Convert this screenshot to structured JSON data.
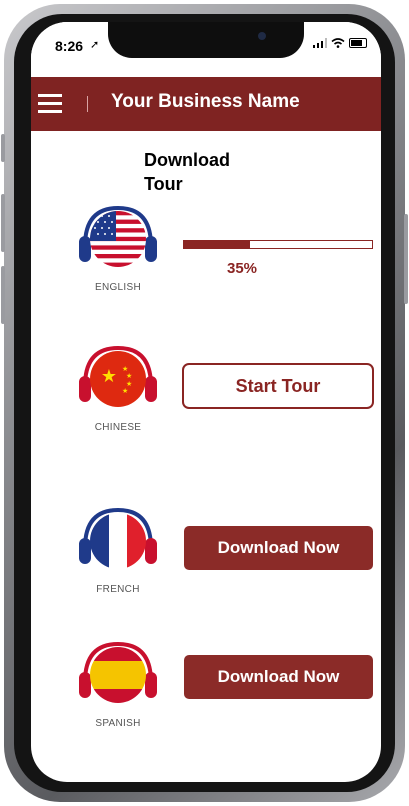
{
  "status_bar": {
    "time": "8:26",
    "signal": "all",
    "wifi": "wifi",
    "battery": "full"
  },
  "header": {
    "menu_icon": "hamburger-menu-icon",
    "title": "Your Business Name",
    "color": "#7f2322"
  },
  "section": {
    "title": "Download Tour"
  },
  "languages": [
    {
      "label": "ENGLISH",
      "flag": "us-flag-headphones-icon",
      "progress_percent": 35,
      "progress_text": "35%"
    },
    {
      "label": "CHINESE",
      "flag": "china-flag-headphones-icon",
      "button": "Start Tour"
    },
    {
      "label": "FRENCH",
      "flag": "france-flag-headphones-icon",
      "button": "Download Now"
    },
    {
      "label": "SPANISH",
      "flag": "spain-flag-headphones-icon",
      "button": "Download Now"
    }
  ],
  "colors": {
    "accent": "#8a2523",
    "button_fill": "#8b2b28"
  }
}
